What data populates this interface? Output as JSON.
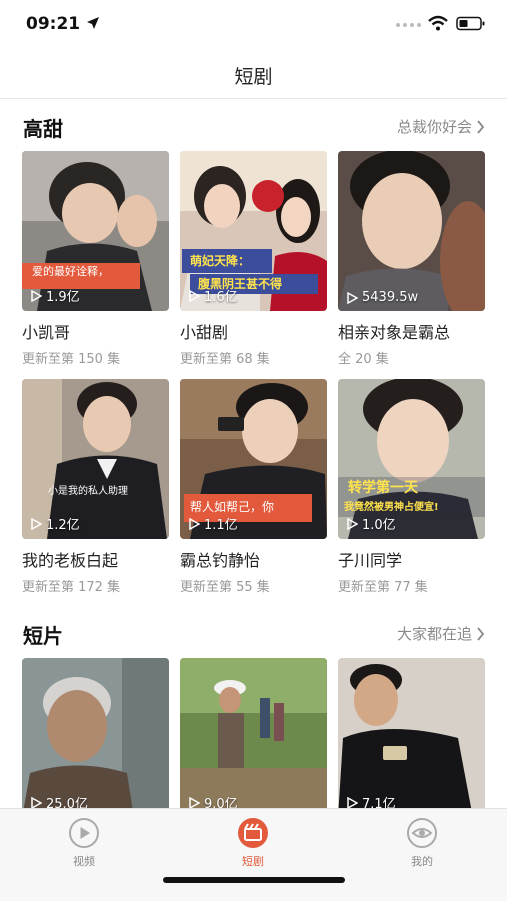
{
  "status_bar": {
    "time": "09:21"
  },
  "nav": {
    "title": "短剧"
  },
  "sections": [
    {
      "title": "高甜",
      "more": "总裁你好会",
      "cards": [
        {
          "title": "小凯哥",
          "sub": "更新至第 150 集",
          "plays": "1.9亿",
          "caption": "爱的最好诠释，"
        },
        {
          "title": "小甜剧",
          "sub": "更新至第 68 集",
          "plays": "1.6亿",
          "caption": "萌妃天降：",
          "caption2": "腹黑阴王甚不得"
        },
        {
          "title": "相亲对象是霸总",
          "sub": "全 20 集",
          "plays": "5439.5w"
        }
      ]
    },
    {
      "title": "",
      "more": "",
      "cards": [
        {
          "title": "我的老板白起",
          "sub": "更新至第 172 集",
          "plays": "1.2亿",
          "caption": "小是我的私人助理"
        },
        {
          "title": "霸总钓静怡",
          "sub": "更新至第 55 集",
          "plays": "1.1亿",
          "caption": "帮人如帮己，你"
        },
        {
          "title": "子川同学",
          "sub": "更新至第 77 集",
          "plays": "1.0亿",
          "caption": "转学第一天",
          "caption2": "我竟然被男神占便宜!"
        }
      ]
    },
    {
      "title": "短片",
      "more": "大家都在追",
      "cards": [
        {
          "plays": "25.0亿"
        },
        {
          "plays": "9.0亿"
        },
        {
          "plays": "7.1亿"
        }
      ]
    }
  ],
  "tabs": [
    {
      "label": "视频",
      "icon": "play-circle-icon"
    },
    {
      "label": "短剧",
      "icon": "clapper-icon"
    },
    {
      "label": "我的",
      "icon": "eye-icon"
    }
  ],
  "colors": {
    "accent": "#e2593c",
    "muted": "#999999",
    "tab_inactive": "#888888"
  }
}
